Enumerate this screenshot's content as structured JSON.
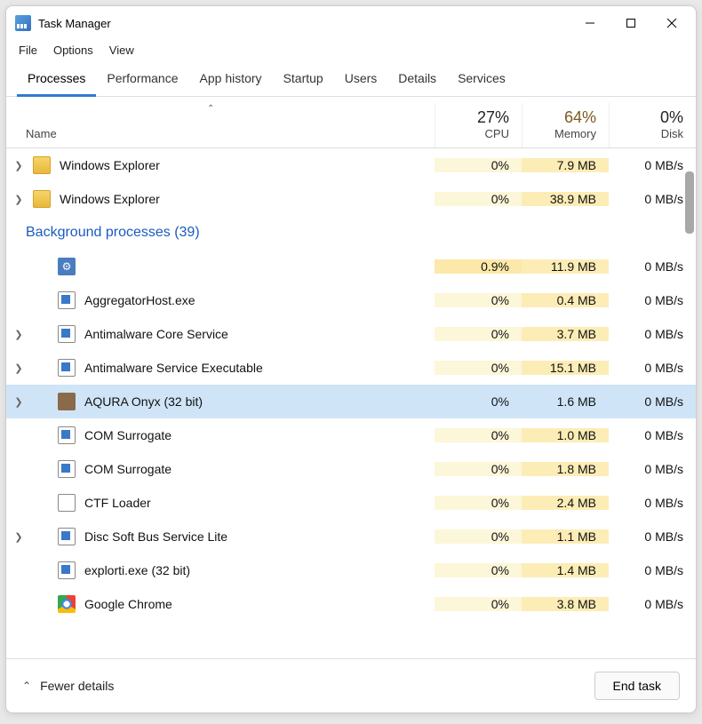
{
  "window": {
    "title": "Task Manager"
  },
  "menu": {
    "file": "File",
    "options": "Options",
    "view": "View"
  },
  "tabs": {
    "processes": "Processes",
    "performance": "Performance",
    "history": "App history",
    "startup": "Startup",
    "users": "Users",
    "details": "Details",
    "services": "Services"
  },
  "columns": {
    "name": "Name",
    "cpu_pct": "27%",
    "cpu_lbl": "CPU",
    "mem_pct": "64%",
    "mem_lbl": "Memory",
    "disk_pct": "0%",
    "disk_lbl": "Disk"
  },
  "group_header": "Background processes (39)",
  "rows": [
    {
      "expand": true,
      "icon": "folder",
      "name": "Windows Explorer",
      "cpu": "0%",
      "mem": "7.9 MB",
      "disk": "0 MB/s",
      "selected": false
    },
    {
      "expand": true,
      "icon": "folder",
      "name": "Windows Explorer",
      "cpu": "0%",
      "mem": "38.9 MB",
      "disk": "0 MB/s",
      "selected": false
    }
  ],
  "bg_rows": [
    {
      "expand": false,
      "icon": "gear",
      "name": "",
      "cpu": "0.9%",
      "mem": "11.9 MB",
      "disk": "0 MB/s",
      "selected": false,
      "hot": true
    },
    {
      "expand": false,
      "icon": "app",
      "name": "AggregatorHost.exe",
      "cpu": "0%",
      "mem": "0.4 MB",
      "disk": "0 MB/s",
      "selected": false
    },
    {
      "expand": true,
      "icon": "app",
      "name": "Antimalware Core Service",
      "cpu": "0%",
      "mem": "3.7 MB",
      "disk": "0 MB/s",
      "selected": false
    },
    {
      "expand": true,
      "icon": "app",
      "name": "Antimalware Service Executable",
      "cpu": "0%",
      "mem": "15.1 MB",
      "disk": "0 MB/s",
      "selected": false
    },
    {
      "expand": true,
      "icon": "aq",
      "name": "AQURA Onyx (32 bit)",
      "cpu": "0%",
      "mem": "1.6 MB",
      "disk": "0 MB/s",
      "selected": true
    },
    {
      "expand": false,
      "icon": "app",
      "name": "COM Surrogate",
      "cpu": "0%",
      "mem": "1.0 MB",
      "disk": "0 MB/s",
      "selected": false
    },
    {
      "expand": false,
      "icon": "app",
      "name": "COM Surrogate",
      "cpu": "0%",
      "mem": "1.8 MB",
      "disk": "0 MB/s",
      "selected": false
    },
    {
      "expand": false,
      "icon": "ctf",
      "name": "CTF Loader",
      "cpu": "0%",
      "mem": "2.4 MB",
      "disk": "0 MB/s",
      "selected": false
    },
    {
      "expand": true,
      "icon": "app",
      "name": "Disc Soft Bus Service Lite",
      "cpu": "0%",
      "mem": "1.1 MB",
      "disk": "0 MB/s",
      "selected": false
    },
    {
      "expand": false,
      "icon": "app",
      "name": "explorti.exe (32 bit)",
      "cpu": "0%",
      "mem": "1.4 MB",
      "disk": "0 MB/s",
      "selected": false
    },
    {
      "expand": false,
      "icon": "chrome",
      "name": "Google Chrome",
      "cpu": "0%",
      "mem": "3.8 MB",
      "disk": "0 MB/s",
      "selected": false
    }
  ],
  "footer": {
    "fewer": "Fewer details",
    "end_task": "End task"
  }
}
